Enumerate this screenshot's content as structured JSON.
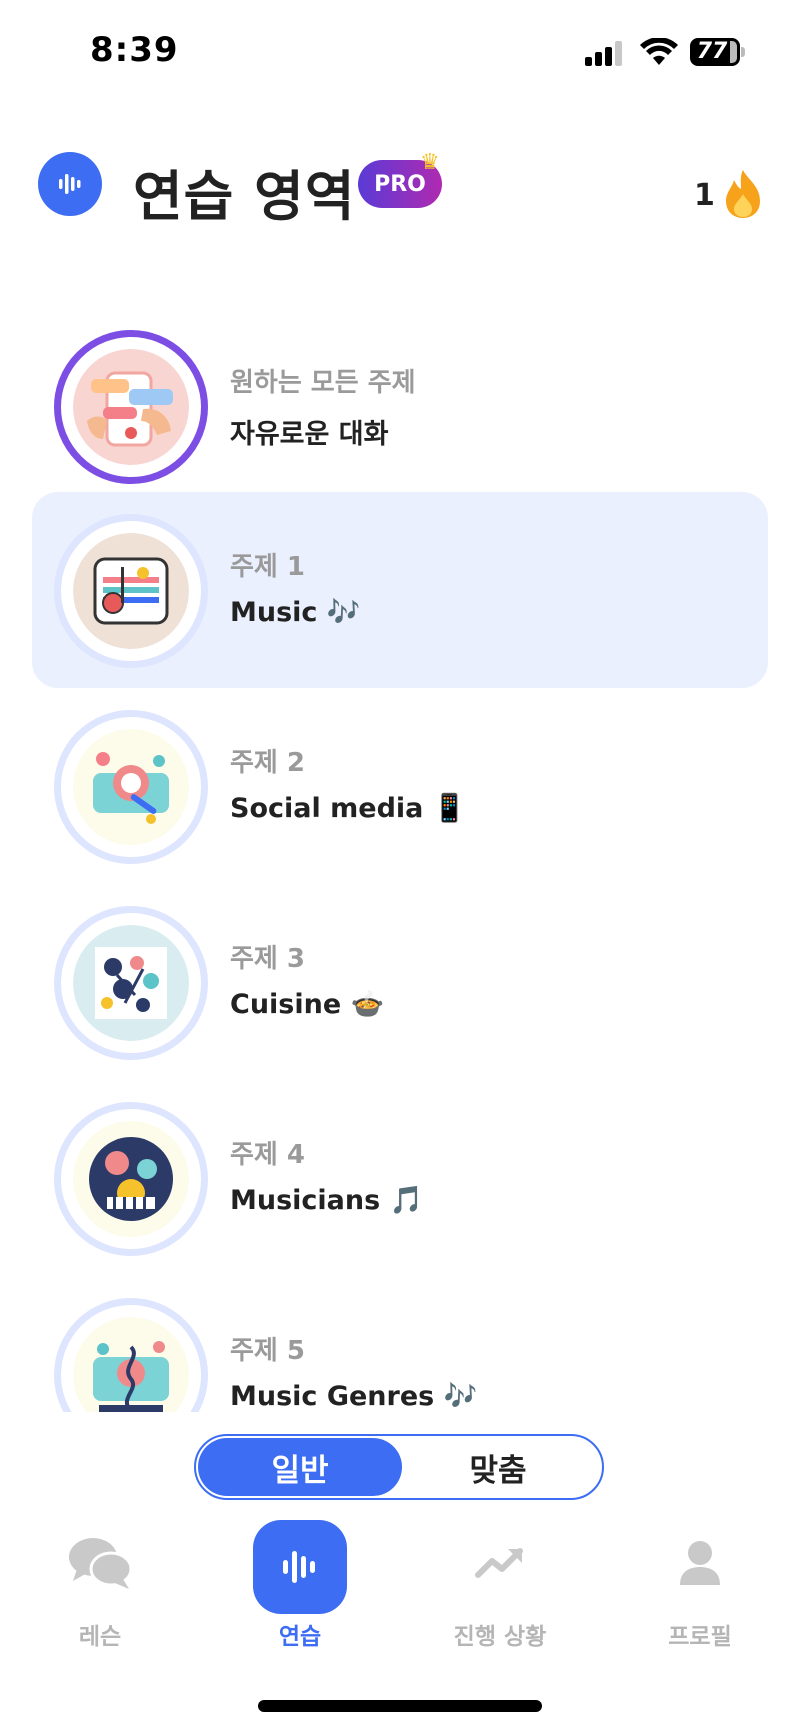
{
  "status_bar": {
    "time": "8:39",
    "battery": "77"
  },
  "header": {
    "title": "연습 영역",
    "pro_badge": "PRO",
    "streak_count": "1"
  },
  "topics": [
    {
      "subtitle": "원하는 모든 주제",
      "name": "자유로운 대화",
      "icon": "chat-phone-illustration",
      "selected": false
    },
    {
      "subtitle": "주제 1",
      "name": "Music 🎶",
      "icon": "music-illustration",
      "selected": true
    },
    {
      "subtitle": "주제 2",
      "name": "Social media 📱",
      "icon": "social-media-illustration",
      "selected": false
    },
    {
      "subtitle": "주제 3",
      "name": "Cuisine 🍲",
      "icon": "cuisine-illustration",
      "selected": false
    },
    {
      "subtitle": "주제 4",
      "name": "Musicians 🎵",
      "icon": "musicians-illustration",
      "selected": false
    },
    {
      "subtitle": "주제 5",
      "name": "Music Genres 🎶",
      "icon": "music-genres-illustration",
      "selected": false
    }
  ],
  "segment": {
    "general": "일반",
    "custom": "맞춤",
    "active": "일반"
  },
  "nav": {
    "lessons": "레슨",
    "practice": "연습",
    "progress": "진행 상황",
    "profile": "프로필",
    "active": "연습"
  },
  "colors": {
    "accent": "#3d6df2",
    "selected_row": "#ebf0ff",
    "pro_gradient_start": "#5a3bd6",
    "pro_gradient_end": "#b02ab0",
    "free_ring": "#7c4ee4"
  }
}
